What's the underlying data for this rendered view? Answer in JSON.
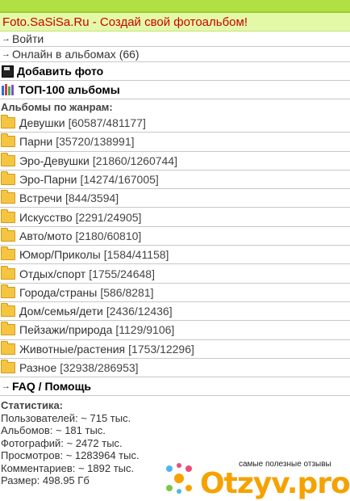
{
  "header": {
    "title": "Foto.SaSiSa.Ru - Создай свой фотоальбом!"
  },
  "nav": {
    "login": "Войти",
    "online": "Онлайн в альбомах (66)"
  },
  "actions": {
    "add_photo": "Добавить фото",
    "top100": "ТОП-100 альбомы"
  },
  "genres": {
    "heading": "Альбомы по жанрам:",
    "items": [
      {
        "label": "Девушки",
        "count": "[60587/481177]"
      },
      {
        "label": "Парни",
        "count": "[35720/138991]"
      },
      {
        "label": "Эро-Девушки",
        "count": "[21860/1260744]"
      },
      {
        "label": "Эро-Парни",
        "count": "[14274/167005]"
      },
      {
        "label": "Встречи",
        "count": "[844/3594]"
      },
      {
        "label": "Искусство",
        "count": "[2291/24905]"
      },
      {
        "label": "Авто/мото",
        "count": "[2180/60810]"
      },
      {
        "label": "Юмор/Приколы",
        "count": "[1584/41158]"
      },
      {
        "label": "Отдых/спорт",
        "count": "[1755/24648]"
      },
      {
        "label": "Города/страны",
        "count": "[586/8281]"
      },
      {
        "label": "Дом/семья/дети",
        "count": "[2436/12436]"
      },
      {
        "label": "Пейзажи/природа",
        "count": "[1129/9106]"
      },
      {
        "label": "Животные/растения",
        "count": "[1753/12296]"
      },
      {
        "label": "Разное",
        "count": "[32938/286953]"
      }
    ]
  },
  "faq": {
    "label": "FAQ / Помощь"
  },
  "stats": {
    "heading": "Статистика:",
    "lines": [
      "Пользователей: ~ 715 тыс.",
      "Альбомов: ~ 181 тыс.",
      "Фотографий: ~ 2472 тыс.",
      "Просмотров: ~ 1283964 тыс.",
      "Комментариев: ~ 1892 тыс.",
      "Размер: 498.95 Гб"
    ]
  },
  "watermark": {
    "brand": "Otzyv.pro",
    "tagline": "самые полезные отзывы"
  },
  "colors": {
    "accent_green": "#b0e043",
    "title_bg": "#e4f9a8",
    "title_text": "#cc0000",
    "folder": "#f5c542",
    "brand_orange": "#f5a200"
  }
}
